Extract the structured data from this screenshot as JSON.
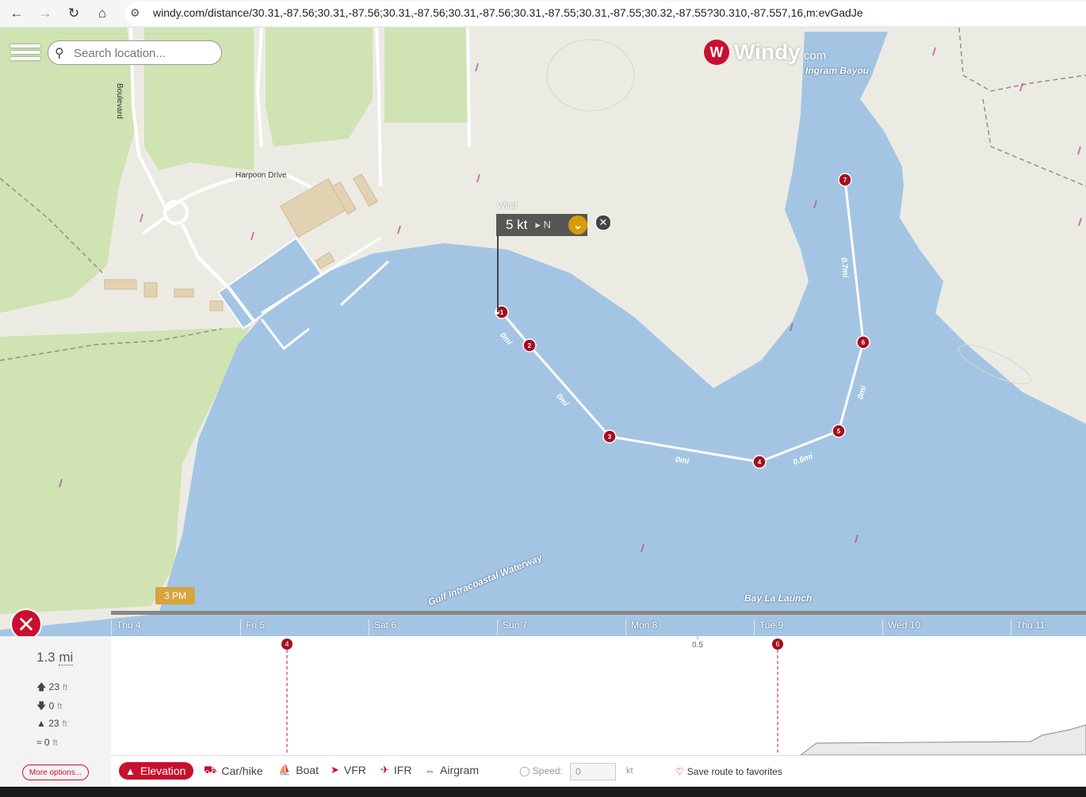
{
  "browser": {
    "url": "windy.com/distance/30.31,-87.56;30.31,-87.56;30.31,-87.56;30.31,-87.56;30.31,-87.55;30.31,-87.55;30.32,-87.55?30.310,-87.557,16,m:evGadJe",
    "back_icon": "arrow-left-icon",
    "forward_icon": "arrow-right-icon",
    "reload_icon": "reload-icon",
    "home_icon": "home-icon"
  },
  "map": {
    "search_placeholder": "Search location...",
    "logo_word": "Windy",
    "logo_com": ".com",
    "labels": {
      "ingram": "Ingram Bayou",
      "harpoon": "Harpoon Drive",
      "boulevard": "Boulevard",
      "gulf": "Gulf Intracoastal Waterway",
      "baylalaunch": "Bay La Launch"
    },
    "colors": {
      "water": "#a3c5e3",
      "land": "#ecebe3",
      "park": "#cfe3b3",
      "route": "#ffffff",
      "marker": "#a50e1e"
    }
  },
  "wind": {
    "label": "Wind",
    "speed": "5 kt",
    "direction": "N"
  },
  "route": {
    "waypoints": [
      "1",
      "2",
      "3",
      "4",
      "5",
      "6",
      "7"
    ],
    "segments": [
      "0mi",
      "0mi",
      "0mi",
      "0.6mi",
      "0mi",
      "0.7mi"
    ]
  },
  "timeline": {
    "current_time": "3 PM",
    "days": [
      "Thu 4",
      "Fri 5",
      "Sat 6",
      "Sun 7",
      "Mon 8",
      "Tue 9",
      "Wed 10",
      "Thu 11"
    ]
  },
  "stats": {
    "distance_value": "1.3",
    "distance_unit": "mi",
    "ascent_value": "23",
    "descent_value": "0",
    "max_value": "23",
    "min_value": "0",
    "unit": "ft",
    "more_options": "More options..."
  },
  "profile": {
    "marker_a": "4",
    "marker_b": "6",
    "scale_label": "0.5"
  },
  "modes": {
    "elevation": "Elevation",
    "carhike": "Car/hike",
    "boat": "Boat",
    "vfr": "VFR",
    "ifr": "IFR",
    "airgram": "Airgram",
    "active": "Elevation"
  },
  "speed": {
    "label": "Speed:",
    "value": "0",
    "unit": "kt"
  },
  "favorites": "Save route to favorites"
}
